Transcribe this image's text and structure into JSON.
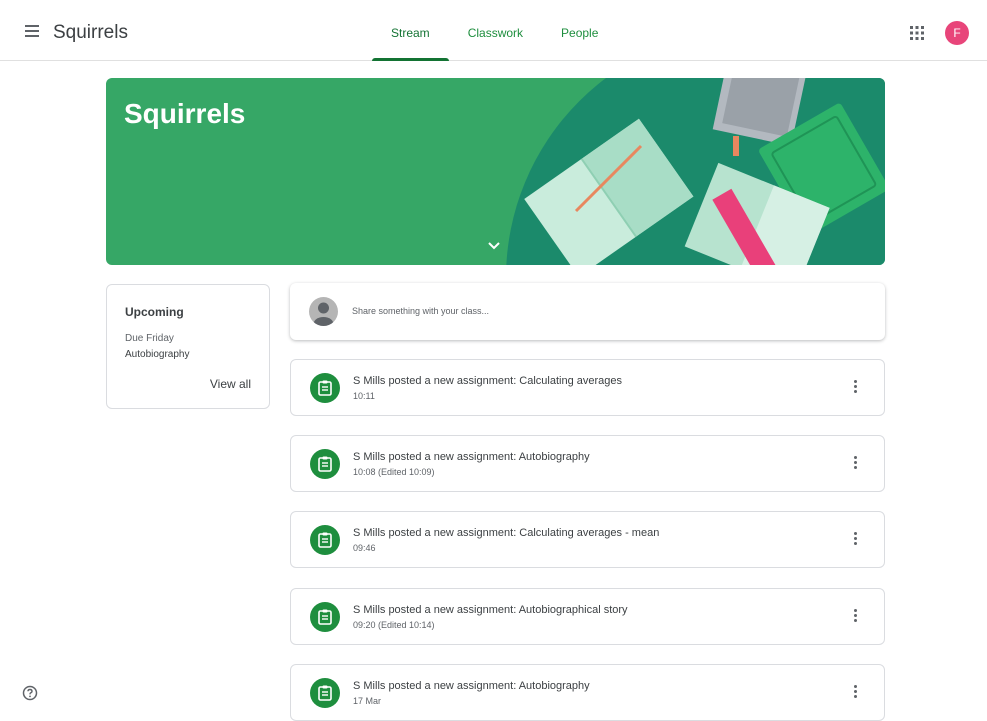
{
  "header": {
    "class_name": "Squirrels",
    "tabs": [
      {
        "label": "Stream",
        "active": true
      },
      {
        "label": "Classwork",
        "active": false
      },
      {
        "label": "People",
        "active": false
      }
    ],
    "avatar_initial": "F",
    "avatar_color": "#e8457a"
  },
  "banner": {
    "title": "Squirrels",
    "color": "#36a766"
  },
  "upcoming": {
    "title": "Upcoming",
    "due_label": "Due Friday",
    "item": "Autobiography",
    "view_all": "View all"
  },
  "share": {
    "placeholder": "Share something with your class..."
  },
  "posts": [
    {
      "title": "S Mills posted a new assignment: Calculating averages",
      "time": "10:11"
    },
    {
      "title": "S Mills posted a new assignment: Autobiography",
      "time": "10:08 (Edited 10:09)"
    },
    {
      "title": "S Mills posted a new assignment: Calculating averages - mean",
      "time": "09:46"
    },
    {
      "title": "S Mills posted a new assignment: Autobiographical story",
      "time": "09:20 (Edited 10:14)"
    },
    {
      "title": "S Mills posted a new assignment: Autobiography",
      "time": "17 Mar"
    }
  ],
  "icons": {
    "menu": "hamburger-menu-icon",
    "apps": "apps-grid-icon",
    "assignment": "assignment-icon",
    "more": "more-vert-icon",
    "help": "help-icon",
    "chevron": "chevron-down-icon"
  },
  "colors": {
    "accent": "#1e8e3e",
    "accent_dark": "#137333"
  }
}
